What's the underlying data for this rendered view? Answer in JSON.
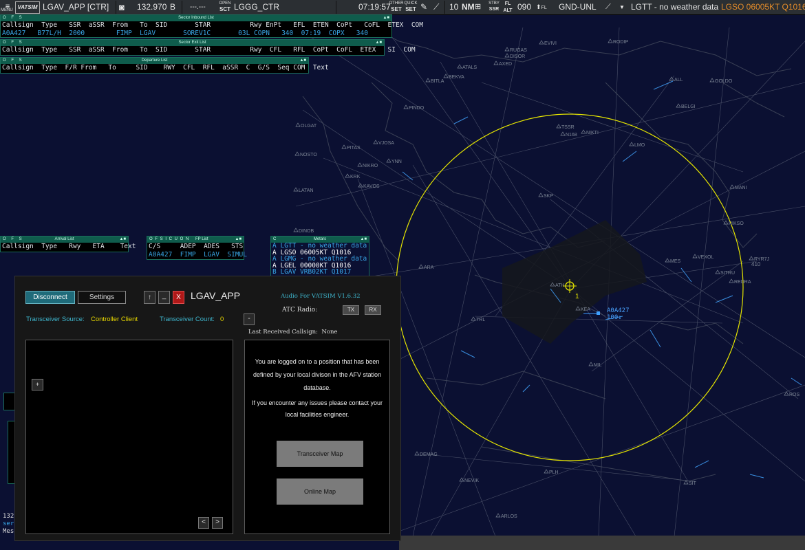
{
  "topbar": {
    "menu_label": "MENU",
    "vatsim_logo": "VATSIM",
    "position_title": "LGAV_APP [CTR]",
    "headset_icon": "headset-icon",
    "frequency": "132.970",
    "freq_mode": "B",
    "secondary_freq": "---.---",
    "open_sct_label_top": "OPEN",
    "open_sct_label_bottom": "SCT",
    "open_sector": "LGGG_CTR",
    "time": "07:19:57",
    "other_set_top": "OTHER",
    "other_set_bottom": "SET",
    "quick_set_top": "QUICK",
    "quick_set_bottom": "SET",
    "range_value": "10",
    "range_unit": "NM",
    "stby_top": "STBY",
    "stby_bottom": "SSR",
    "fl_top": "FL",
    "fl_bottom": "ALT",
    "transition": "090",
    "fl_label": "FL",
    "filter_range": "GND-UNL",
    "metar_airport": "LGTT - no weather data",
    "metar_highlight": "LGSO 06005KT Q1016"
  },
  "sector_inbound": {
    "title": "Sector Inbound List",
    "ofs": "O F S",
    "header": "Callsign  Type   SSR  aSSR  From   To  SID       STAR          Rwy EnPt   EFL  ETEN  CoPt   CoFL  ETEX  COM",
    "rows": [
      "A0A427   B77L/H  2000        FIMP  LGAV       SOREV1C       03L COPN   340  07:19  COPX   340"
    ]
  },
  "sector_exit": {
    "title": "Sector Exit List",
    "ofs": "O F S",
    "header": "Callsign  Type   SSR  aSSR  From   To  SID       STAR          Rwy  CFL   RFL  CoPt  CoFL  ETEX   SI  COM"
  },
  "departure_list": {
    "title": "Departure List",
    "ofs": "O F S",
    "header": "Callsign  Type  F/R From   To     SID    RWY  CFL  RFL  aSSR  C  G/S  Seq COM  Text"
  },
  "arrival_list": {
    "title": "Arrival List",
    "ofs": "O F S",
    "header": "Callsign  Type   Rwy   ETA    Text"
  },
  "fp_list": {
    "title": "FP List",
    "ofs": "O F S I C U O N",
    "header": "C/S     ADEP  ADES   STS",
    "rows": [
      "A0A427  FIMP  LGAV  SIMUL"
    ]
  },
  "metars": {
    "title": "Metars",
    "ofs": "C",
    "rows": [
      {
        "text": "A LGTT - no weather data",
        "color": "#39a7e8"
      },
      {
        "text": "A LGSO 06005KT Q1016",
        "color": "#ffffff"
      },
      {
        "text": "A LGMG - no weather data",
        "color": "#39a7e8"
      },
      {
        "text": "A LGEL 00000KT Q1016",
        "color": "#ffffff"
      },
      {
        "text": "B LGAV VRB02KT Q1017",
        "color": "#39a7e8"
      }
    ]
  },
  "map": {
    "fixes": [
      {
        "label": "EVIVI"
      },
      {
        "label": "RODIP"
      },
      {
        "label": "RUGAS"
      },
      {
        "label": "DISOR"
      },
      {
        "label": "ATALS"
      },
      {
        "label": "AXED"
      },
      {
        "label": "BEKVA"
      },
      {
        "label": "BITLA"
      },
      {
        "label": "ALL"
      },
      {
        "label": "GOLDO"
      },
      {
        "label": "PINDO"
      },
      {
        "label": "BELGI"
      },
      {
        "label": "OLGAT"
      },
      {
        "label": "NIKTI"
      },
      {
        "label": "TSSR"
      },
      {
        "label": "N168"
      },
      {
        "label": "PITAS"
      },
      {
        "label": "VJOSA"
      },
      {
        "label": "NOSTO"
      },
      {
        "label": "LMO"
      },
      {
        "label": "YNN"
      },
      {
        "label": "NIKRO"
      },
      {
        "label": "KRK"
      },
      {
        "label": "KAVOS"
      },
      {
        "label": "LATAN"
      },
      {
        "label": "MANI"
      },
      {
        "label": "SKP"
      },
      {
        "label": "DINOB"
      },
      {
        "label": "RIKSO"
      },
      {
        "label": "ARA"
      },
      {
        "label": "MES"
      },
      {
        "label": "VEXOL"
      },
      {
        "label": "SITRU"
      },
      {
        "label": "REDRA"
      },
      {
        "label": "ATH"
      },
      {
        "label": "KEA"
      },
      {
        "label": "TRL"
      },
      {
        "label": "MIL"
      },
      {
        "label": "ROS"
      },
      {
        "label": "DEMAG"
      },
      {
        "label": "PLH"
      },
      {
        "label": "NEVIK"
      },
      {
        "label": "SIT"
      },
      {
        "label": "ARLOS"
      },
      {
        "label": "RYR7J"
      }
    ],
    "ryr_alt": "410",
    "target_callsign": "A0A427",
    "target_alt": "100↓",
    "marker_number": "1",
    "ring_color": "#e5e500"
  },
  "left_partial": {
    "freq": "132",
    "line2": "ser",
    "line3": "Mes"
  },
  "afv": {
    "disconnect_label": "Disconnect",
    "settings_label": "Settings",
    "up_label": "↑",
    "min_label": "_",
    "close_label": "X",
    "title": "LGAV_APP",
    "version": "Audio For VATSIM V1.6.32",
    "atc_radio_label": "ATC Radio:",
    "tx_label": "TX",
    "rx_label": "RX",
    "transceiver_source_label": "Transceiver Source:",
    "transceiver_source_value": "Controller Client",
    "transceiver_count_label": "Transceiver Count:",
    "transceiver_count_value": "0",
    "collapse_label": "-",
    "last_received_label": "Last Received Callsign:",
    "last_received_value": "None",
    "add_label": "+",
    "prev_label": "<",
    "next_label": ">",
    "info_p1": "You are logged on to a position that has been defined by your local divison in the AFV station database.",
    "info_p2": "If you encounter any issues please contact your local facilities engineer.",
    "transceiver_map_label": "Transceiver Map",
    "online_map_label": "Online Map",
    "accent_color": "#3fb8d0",
    "value_color": "#e8d800"
  }
}
